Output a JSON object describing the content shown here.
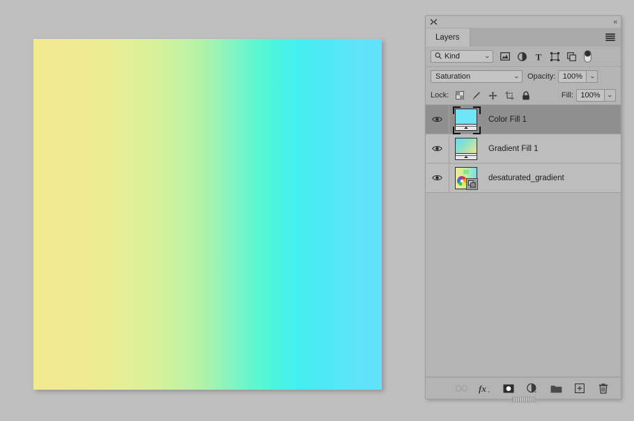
{
  "canvas": {
    "name": "document-canvas",
    "gradient_description": "horizontal gradient yellow to green to cyan",
    "colors": [
      "#f2e98f",
      "#d5f19a",
      "#7df5c4",
      "#44f0ef",
      "#62e2fa"
    ]
  },
  "panel": {
    "title": "Layers",
    "close_label": "✖",
    "collapse_label": "«",
    "menu_label": "panel-menu"
  },
  "filter_row": {
    "kind_label": "Kind",
    "search_icon": "search-icon",
    "caret": "⌄",
    "icons": [
      {
        "name": "filter-pixel-icon",
        "title": "Pixel layers"
      },
      {
        "name": "filter-adjustment-icon",
        "title": "Adjustment layers"
      },
      {
        "name": "filter-type-icon",
        "title": "Type layers",
        "glyph": "T"
      },
      {
        "name": "filter-shape-icon",
        "title": "Shape layers"
      },
      {
        "name": "filter-smartobject-icon",
        "title": "Smart objects"
      },
      {
        "name": "filter-toggle-switch",
        "title": "Turn filtering on/off"
      }
    ]
  },
  "blend_row": {
    "blend_mode": "Saturation",
    "opacity_label": "Opacity:",
    "opacity_value": "100%",
    "caret": "⌄"
  },
  "lock_row": {
    "lock_label": "Lock:",
    "fill_label": "Fill:",
    "fill_value": "100%",
    "icons": [
      {
        "name": "lock-transparent-pixels-icon"
      },
      {
        "name": "lock-image-pixels-icon"
      },
      {
        "name": "lock-position-icon"
      },
      {
        "name": "lock-artboard-nesting-icon"
      },
      {
        "name": "lock-all-icon"
      }
    ]
  },
  "layers": [
    {
      "name": "Color Fill 1",
      "selected": true,
      "visible": true,
      "thumb_type": "solid",
      "thumb_colors": [
        "#6fe4f7",
        "#6fe4f7"
      ],
      "has_slider": true,
      "smart_object": false
    },
    {
      "name": "Gradient Fill 1",
      "selected": false,
      "visible": true,
      "thumb_type": "gradient",
      "thumb_colors": [
        "#63d8f2",
        "#f0e78e"
      ],
      "has_slider": true,
      "smart_object": false
    },
    {
      "name": "desaturated_gradient",
      "selected": false,
      "visible": true,
      "thumb_type": "image",
      "thumb_colors": [
        "#f3ea8d",
        "#6fe0f2"
      ],
      "has_slider": false,
      "smart_object": true
    }
  ],
  "footer": {
    "buttons": [
      {
        "name": "link-layers-button",
        "label": "Link layers",
        "disabled": true
      },
      {
        "name": "layer-style-button",
        "label": "Add a layer style"
      },
      {
        "name": "layer-mask-button",
        "label": "Add layer mask"
      },
      {
        "name": "adjustment-layer-button",
        "label": "Create new fill or adjustment layer"
      },
      {
        "name": "new-group-button",
        "label": "Create a new group"
      },
      {
        "name": "new-layer-button",
        "label": "Create a new layer"
      },
      {
        "name": "delete-layer-button",
        "label": "Delete layer"
      }
    ]
  },
  "colors": {
    "app_background": "#bfbfbf",
    "panel_background": "#b4b4b4",
    "row_background": "#bdbdbd",
    "row_selected": "#8f8f8f",
    "text": "#1c1c1c"
  }
}
